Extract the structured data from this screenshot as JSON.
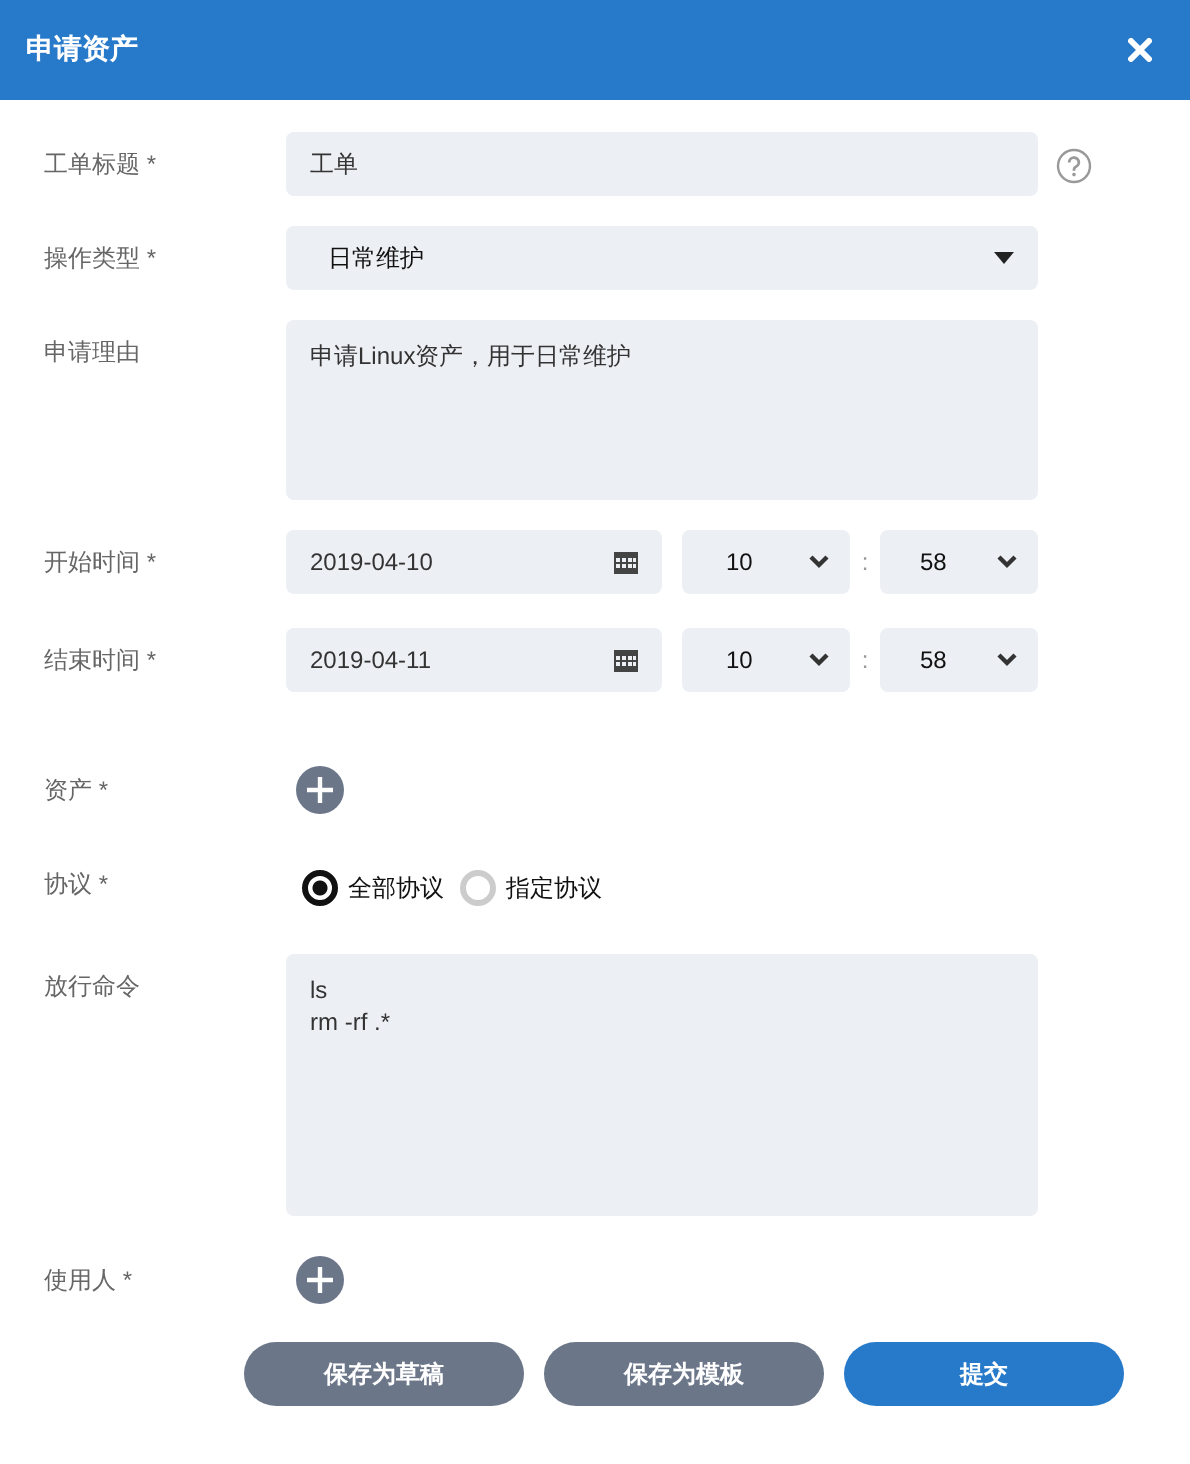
{
  "window": {
    "title": "申请资产"
  },
  "fields": [
    {
      "kind": "text",
      "label": "工单标题 *",
      "value": "工单",
      "help": true
    },
    {
      "kind": "select",
      "label": "操作类型 *",
      "value": "日常维护"
    },
    {
      "kind": "textarea",
      "label": "申请理由",
      "value": "申请Linux资产，用于日常维护"
    },
    {
      "kind": "datetime",
      "label": "开始时间 *",
      "date": "2019-04-10",
      "hour": "10",
      "separator": ":",
      "minute": "58"
    },
    {
      "kind": "datetime",
      "label": "结束时间 *",
      "date": "2019-04-11",
      "hour": "10",
      "separator": ":",
      "minute": "58"
    },
    {
      "kind": "add",
      "label": "资产 *"
    },
    {
      "kind": "radio",
      "label": "协议 *",
      "options": [
        {
          "label": "全部协议",
          "selected": true
        },
        {
          "label": "指定协议",
          "selected": false
        }
      ]
    },
    {
      "kind": "textarea",
      "label": "放行命令",
      "value": "ls\nrm -rf .*"
    },
    {
      "kind": "add",
      "label": "使用人 *"
    }
  ],
  "buttons": [
    {
      "label": "保存为草稿",
      "kind": "secondary"
    },
    {
      "label": "保存为模板",
      "kind": "secondary"
    },
    {
      "label": "提交",
      "kind": "primary"
    }
  ]
}
